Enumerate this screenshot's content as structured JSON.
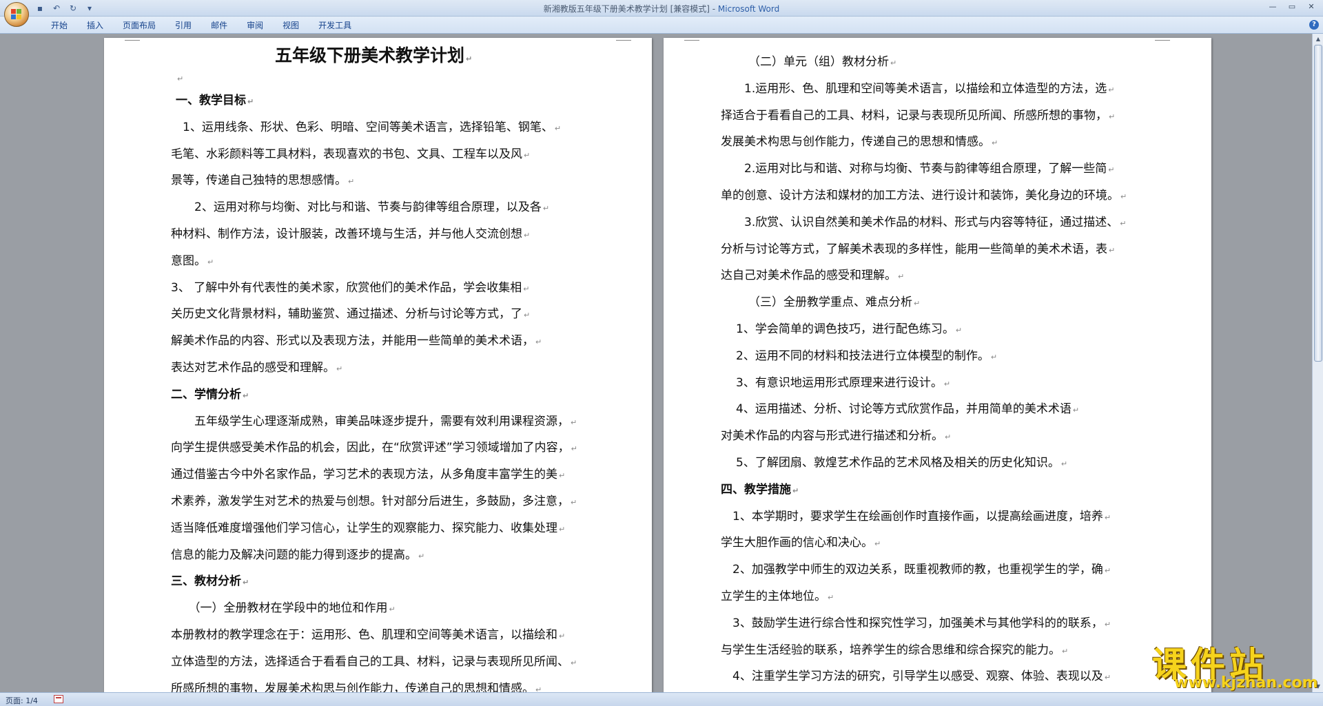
{
  "window": {
    "title_prefix": "新湘教版五年级下册美术教学计划 [兼容模式] - ",
    "title_app": "Microsoft Word"
  },
  "ribbon": {
    "tabs": [
      "开始",
      "插入",
      "页面布局",
      "引用",
      "邮件",
      "审阅",
      "视图",
      "开发工具"
    ]
  },
  "status": {
    "page": "页面: 1/4"
  },
  "watermark": {
    "main": "课件站",
    "url": "www.kjzhan.com"
  },
  "paragraph_mark": "↵",
  "page_left": {
    "title": "五年级下册美术教学计划",
    "lines": [
      "一、教学目标",
      "　1、运用线条、形状、色彩、明暗、空间等美术语言，选择铅笔、钢笔、",
      "毛笔、水彩颜料等工具材料，表现喜欢的书包、文具、工程车以及风",
      "景等，传递自己独特的思想感情。",
      "　　2、运用对称与均衡、对比与和谐、节奏与韵律等组合原理，以及各",
      "种材料、制作方法，设计服装，改善环境与生活，并与他人交流创想",
      "意图。",
      "3、 了解中外有代表性的美术家，欣赏他们的美术作品，学会收集相",
      "关历史文化背景材料，辅助鉴赏、通过描述、分析与讨论等方式，了",
      "解美术作品的内容、形式以及表现方法，并能用一些简单的美术术语，",
      "表达对艺术作品的感受和理解。",
      "二、学情分析",
      "　　五年级学生心理逐渐成熟，审美品味逐步提升，需要有效利用课程资源，",
      "向学生提供感受美术作品的机会，因此，在“欣赏评述”学习领域增加了内容，",
      "通过借鉴古今中外名家作品，学习艺术的表现方法，从多角度丰富学生的美",
      "术素养，激发学生对艺术的热爱与创想。针对部分后进生，多鼓励，多注意，",
      "适当降低难度增强他们学习信心，让学生的观察能力、探究能力、收集处理",
      "信息的能力及解决问题的能力得到逐步的提高。",
      "三、教材分析",
      "　　（一）全册教材在学段中的地位和作用",
      "本册教材的教学理念在于：运用形、色、肌理和空间等美术语言，以描绘和",
      "立体造型的方法，选择适合于看看自己的工具、材料，记录与表现所见所闻、",
      "所感所想的事物，发展美术构思与创作能力，传递自己的思想和情感。"
    ]
  },
  "page_right": {
    "lines": [
      "（二）单元（组）教材分析",
      "1.运用形、色、肌理和空间等美术语言，以描绘和立体造型的方法，选",
      "择适合于看看自己的工具、材料，记录与表现所见所闻、所感所想的事物，",
      "发展美术构思与创作能力，传递自己的思想和情感。",
      "2.运用对比与和谐、对称与均衡、节奏与韵律等组合原理，了解一些简",
      "单的创意、设计方法和媒材的加工方法、进行设计和装饰，美化身边的环境。",
      "3.欣赏、认识自然美和美术作品的材料、形式与内容等特征，通过描述、",
      "分析与讨论等方式，了解美术表现的多样性，能用一些简单的美术术语，表",
      "达自己对美术作品的感受和理解。",
      "（三）全册教学重点、难点分析",
      "1、学会简单的调色技巧，进行配色练习。",
      "2、运用不同的材料和技法进行立体模型的制作。",
      "3、有意识地运用形式原理来进行设计。",
      "4、运用描述、分析、讨论等方式欣赏作品，并用简单的美术术语",
      "对美术作品的内容与形式进行描述和分析。",
      "5、了解团扇、敦煌艺术作品的艺术风格及相关的历史化知识。",
      "四、教学措施",
      "1、本学期时，要求学生在绘画创作时直接作画，以提高绘画进度，培养",
      "学生大胆作画的信心和决心。",
      "2、加强教学中师生的双边关系，既重视教师的教，也重视学生的学，确",
      "立学生的主体地位。",
      "3、鼓励学生进行综合性和探究性学习，加强美术与其他学科的的联系，",
      "与学生生活经验的联系，培养学生的综合思维和综合探究的能力。",
      "4、注重学生学习方法的研究，引导学生以感受、观察、体验、表现以及"
    ]
  }
}
